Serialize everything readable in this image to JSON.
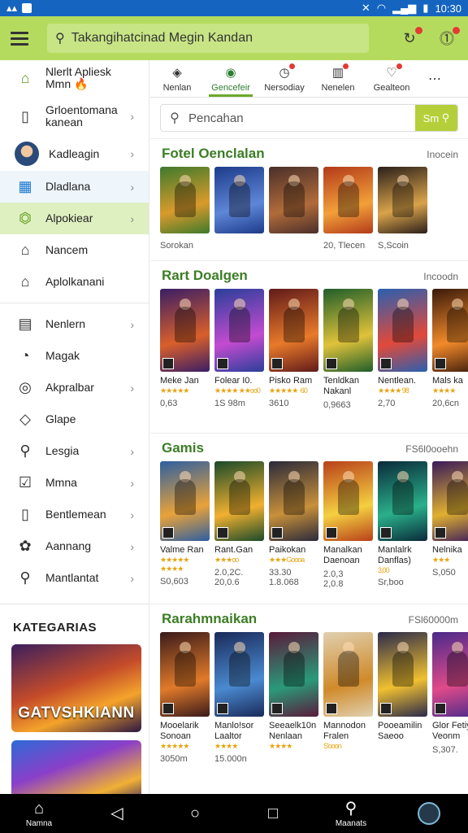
{
  "status": {
    "time": "10:30"
  },
  "topbar": {
    "search_text": "Takangihatcinad Megin Kandan",
    "icons": [
      "menu-icon",
      "refresh-icon",
      "notification-icon"
    ]
  },
  "sidebar": {
    "items": [
      {
        "label": "Nlerlt Apliesk\nMmn 🔥",
        "icon": "home-icon",
        "chevron": false
      },
      {
        "label": "Grloentomana\nkanean",
        "icon": "tablet-icon",
        "chevron": true
      },
      {
        "label": "Kadleagin",
        "icon": "avatar",
        "chevron": true
      },
      {
        "label": "Dladlana",
        "icon": "grid-icon",
        "chevron": true
      },
      {
        "label": "Alpokiear",
        "icon": "android-icon",
        "chevron": true
      },
      {
        "label": "Nancem",
        "icon": "house-icon",
        "chevron": false
      },
      {
        "label": "Aplolkanani",
        "icon": "store-icon",
        "chevron": false
      },
      {
        "label": "Nenlern",
        "icon": "book-icon",
        "chevron": true
      },
      {
        "label": "Magak",
        "icon": "bell-icon",
        "chevron": false
      },
      {
        "label": "Akpralbar",
        "icon": "compass-icon",
        "chevron": true
      },
      {
        "label": "Glape",
        "icon": "tag-icon",
        "chevron": false
      },
      {
        "label": "Lesgia",
        "icon": "search-icon",
        "chevron": true
      },
      {
        "label": "Mmna",
        "icon": "check-icon",
        "chevron": true
      },
      {
        "label": "Bentlemean",
        "icon": "document-icon",
        "chevron": true
      },
      {
        "label": "Aannang",
        "icon": "leaf-icon",
        "chevron": true
      },
      {
        "label": "Mantlantat",
        "icon": "search-icon",
        "chevron": true
      }
    ],
    "categories_title": "KATEGARIAS",
    "banners": [
      "GATVSHKIANN",
      ""
    ]
  },
  "tabs": [
    {
      "label": "Nenlan",
      "icon": "diamond-icon",
      "active": false
    },
    {
      "label": "Gencefeir",
      "icon": "game-icon",
      "active": true
    },
    {
      "label": "Nersodiay",
      "icon": "clock-icon",
      "active": false
    },
    {
      "label": "Nenelen",
      "icon": "chart-icon",
      "active": false
    },
    {
      "label": "Gealteon",
      "icon": "heart-icon",
      "active": false
    }
  ],
  "search": {
    "placeholder": "Pencahan",
    "button": "Sm"
  },
  "sections": [
    {
      "title": "Fotel Oenclalan",
      "more": "Inocein",
      "cards": [
        {
          "title": "",
          "stars": "",
          "meta": "Sorokan",
          "c1": "#3f7a2d",
          "c2": "#d99a2b"
        },
        {
          "title": "",
          "stars": "",
          "meta": "",
          "c1": "#1d3b8a",
          "c2": "#5f86d8"
        },
        {
          "title": "",
          "stars": "",
          "meta": "",
          "c1": "#4a2f2a",
          "c2": "#b16b3a"
        },
        {
          "title": "",
          "stars": "",
          "meta": "20, Tlecen",
          "c1": "#b33a1a",
          "c2": "#f2a03a"
        },
        {
          "title": "",
          "stars": "",
          "meta": "S,Scoin",
          "c1": "#2a1f1a",
          "c2": "#d9a34a"
        }
      ]
    },
    {
      "title": "Rart Doalgen",
      "more": "Incoodn",
      "cards": [
        {
          "title": "Meke Jan",
          "stars": "★★★★★",
          "meta": "0,63",
          "c1": "#3a1e66",
          "c2": "#d95f2a"
        },
        {
          "title": "Folear I0.",
          "stars": "★★★★ ★★oo0",
          "meta": "1S 98m",
          "c1": "#2a3f9a",
          "c2": "#c44bd0"
        },
        {
          "title": "Pisko Ram",
          "stars": "★★★★★ ·60",
          "meta": "3610",
          "c1": "#601a1a",
          "c2": "#e87a2a"
        },
        {
          "title": "Tenldkan\nNakanl",
          "stars": "",
          "meta": "0,9663",
          "c1": "#1f5e2a",
          "c2": "#e0c23a"
        },
        {
          "title": "Nentlean.",
          "stars": "★★★★ 98",
          "meta": "2,70",
          "c1": "#2a5fb0",
          "c2": "#e24a3a"
        },
        {
          "title": "Mals ka",
          "stars": "★★★★",
          "meta": "20,6cn",
          "c1": "#3a1a0a",
          "c2": "#f28a2a"
        }
      ]
    },
    {
      "title": "Gamis",
      "more": "FS6l0ooehn",
      "cards": [
        {
          "title": "Valme Ran",
          "stars": "★★★★★\n★★★★",
          "meta": "S0,603",
          "c1": "#2e5fa0",
          "c2": "#e8a23a"
        },
        {
          "title": "Rant.Gan",
          "stars": "★★★oo",
          "meta": "2.0,2C.\n20,0.6",
          "c1": "#1a4a2a",
          "c2": "#f0b030"
        },
        {
          "title": "Paikokan",
          "stars": "★★★Goooa",
          "meta": "33.30\n1.8.068",
          "c1": "#2a2a3a",
          "c2": "#c8903a"
        },
        {
          "title": "Manalkan\nDaenoan",
          "stars": "",
          "meta": "2.0,3\n2,0.8",
          "c1": "#b8401a",
          "c2": "#f4d040"
        },
        {
          "title": "Manlalrk\nDanflas)",
          "stars": "3,00",
          "meta": "Sr,boo",
          "c1": "#0a2a3a",
          "c2": "#2ab08a"
        },
        {
          "title": "Nelnika",
          "stars": "★★★",
          "meta": "S,050",
          "c1": "#3a1a5a",
          "c2": "#e0b030"
        }
      ]
    },
    {
      "title": "Rarahmnaikan",
      "more": "FSl60000m",
      "cards": [
        {
          "title": "Mooelarik\nSonoan",
          "stars": "★★★★★",
          "meta": "3050m",
          "c1": "#3a1a1a",
          "c2": "#e07a2a"
        },
        {
          "title": "Manlo!sor\nLaaltor",
          "stars": "★★★★",
          "meta": "15.000n",
          "c1": "#1a2a5a",
          "c2": "#4a8ad0"
        },
        {
          "title": "Seeaelk10n\nNenlaan",
          "stars": "★★★★",
          "meta": "",
          "c1": "#5a1a3a",
          "c2": "#2a9a7a"
        },
        {
          "title": "Mannodon\nFralen",
          "stars": "S'ooon",
          "meta": "",
          "c1": "#e0d0b0",
          "c2": "#d08a2a"
        },
        {
          "title": "Pooeamilin\nSaeoo",
          "stars": "",
          "meta": "",
          "c1": "#2a2a4a",
          "c2": "#f0c030"
        },
        {
          "title": "Glor Fetiye\nVeonm",
          "stars": "",
          "meta": "S,307.",
          "c1": "#4a2a8a",
          "c2": "#e04a8a"
        }
      ]
    }
  ],
  "bottomnav": [
    {
      "label": "Namna",
      "icon": "home-icon"
    },
    {
      "label": "",
      "icon": "back-icon"
    },
    {
      "label": "",
      "icon": "circle-home-icon"
    },
    {
      "label": "",
      "icon": "recents-icon"
    },
    {
      "label": "Maanats",
      "icon": "search-icon"
    },
    {
      "label": "",
      "icon": "assistant-icon"
    }
  ]
}
